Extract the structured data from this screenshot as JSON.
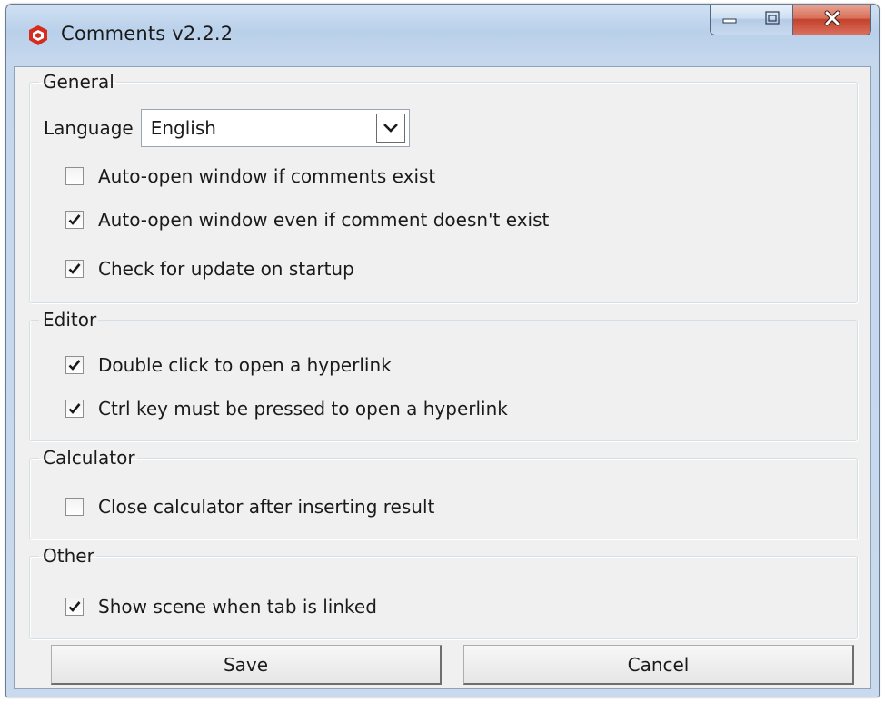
{
  "window": {
    "title": "Comments v2.2.2",
    "accent_colors": {
      "titlebar": "#b9d0ea",
      "close_button": "#c4412b",
      "client_background": "#f0f0f0"
    }
  },
  "sections": {
    "general": {
      "legend": "General",
      "language_label": "Language",
      "language_value": "English",
      "options": [
        {
          "label": "Auto-open window if comments exist",
          "checked": false
        },
        {
          "label": "Auto-open window even if comment doesn't exist",
          "checked": true
        },
        {
          "label": "Check for update on startup",
          "checked": true
        }
      ]
    },
    "editor": {
      "legend": "Editor",
      "options": [
        {
          "label": "Double click to open a hyperlink",
          "checked": true
        },
        {
          "label": "Ctrl key must be pressed to open a hyperlink",
          "checked": true
        }
      ]
    },
    "calculator": {
      "legend": "Calculator",
      "options": [
        {
          "label": "Close calculator after inserting result",
          "checked": false
        }
      ]
    },
    "other": {
      "legend": "Other",
      "options": [
        {
          "label": "Show scene when tab is linked",
          "checked": true
        }
      ]
    }
  },
  "buttons": {
    "save_label": "Save",
    "cancel_label": "Cancel"
  },
  "icons": {
    "app": "sketchup-icon",
    "minimize": "minimize-icon",
    "maximize": "maximize-icon",
    "close": "close-icon",
    "dropdown": "chevron-down-icon",
    "check": "checkmark-icon"
  }
}
